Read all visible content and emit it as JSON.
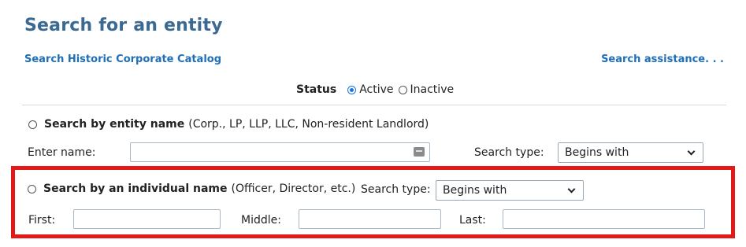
{
  "page": {
    "title": "Search for an entity",
    "historic_link": "Search Historic Corporate Catalog",
    "assistance_link": "Search assistance. . ."
  },
  "status": {
    "label": "Status",
    "options": [
      {
        "label": "Active",
        "checked": true
      },
      {
        "label": "Inactive",
        "checked": false
      }
    ]
  },
  "entity_search": {
    "label": "Search by entity name",
    "hint": "(Corp., LP, LLP, LLC, Non-resident Landlord)",
    "name_label": "Enter name:",
    "name_value": "",
    "search_type_label": "Search type:",
    "search_type_value": "Begins with"
  },
  "individual_search": {
    "label": "Search by an individual name",
    "hint": "(Officer, Director, etc.)",
    "search_type_label": "Search type:",
    "search_type_value": "Begins with",
    "first_label": "First:",
    "middle_label": "Middle:",
    "last_label": "Last:",
    "first_value": "",
    "middle_value": "",
    "last_value": ""
  },
  "colors": {
    "title": "#3a6a93",
    "link": "#1f6fb8",
    "highlight": "#e31919",
    "radio_checked": "#1a73e8"
  },
  "icons": {
    "name_input_icon": "keyboard-icon",
    "dropdown": "chevron-down-icon"
  }
}
